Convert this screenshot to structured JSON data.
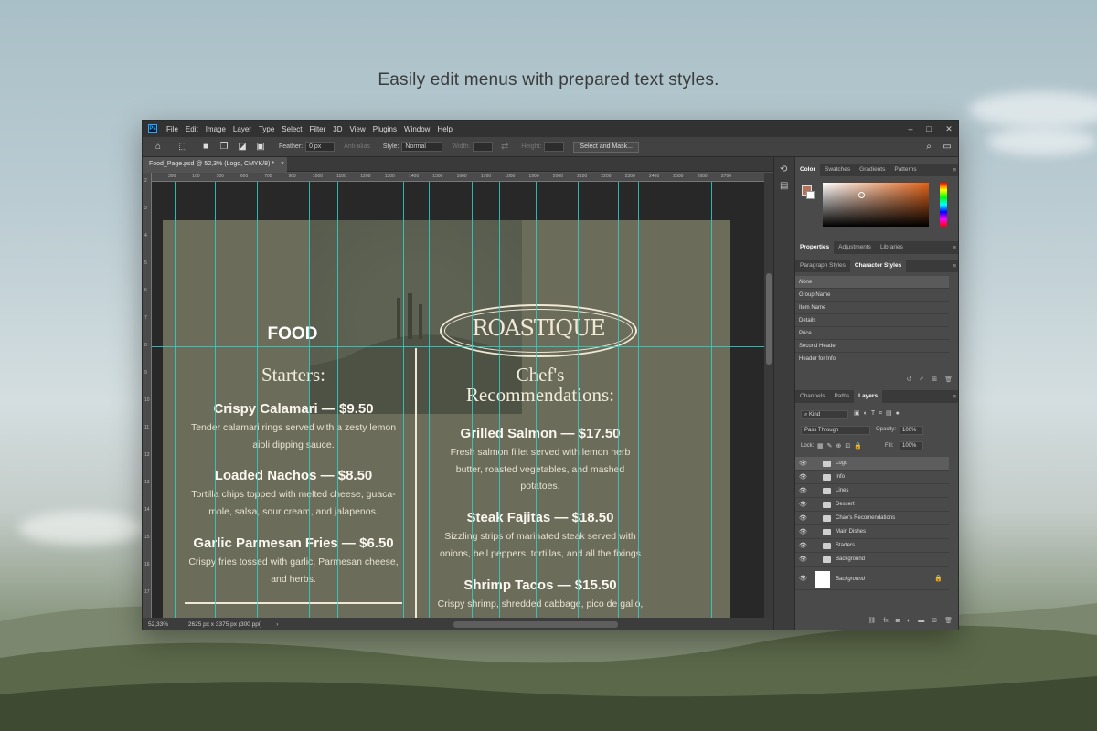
{
  "caption": "Easily edit menus with prepared text styles.",
  "menubar": {
    "logo": "Ps",
    "items": [
      "File",
      "Edit",
      "Image",
      "Layer",
      "Type",
      "Select",
      "Filter",
      "3D",
      "View",
      "Plugins",
      "Window",
      "Help"
    ],
    "controls": [
      "–",
      "□",
      "✕"
    ]
  },
  "options": {
    "feather_label": "Feather:",
    "feather_value": "0 px",
    "anti_alias": "Anti-alias",
    "style_label": "Style:",
    "style_value": "Normal",
    "width_label": "Width:",
    "height_label": "Height:",
    "select_mask": "Select and Mask..."
  },
  "document_tab": {
    "title": "Food_Page.psd @ 52,3% (Logo, CMYK/8) *",
    "close": "×"
  },
  "ruler_h": [
    "300",
    "100",
    "300",
    "600",
    "700",
    "900",
    "1000",
    "1100",
    "1200",
    "1300",
    "1400",
    "1500",
    "1600",
    "1700",
    "1800",
    "1900",
    "2000",
    "2100",
    "2200",
    "2300",
    "2400",
    "2500",
    "2600",
    "2700"
  ],
  "ruler_v": [
    "2",
    "3",
    "4",
    "5",
    "6",
    "7",
    "8",
    "9",
    "10",
    "11",
    "12",
    "13",
    "14",
    "15",
    "16",
    "17"
  ],
  "status": {
    "zoom": "52,33%",
    "size": "2625 px x 3375 px (300 ppi)",
    "arrow": "›"
  },
  "menu": {
    "food_label": "FOOD",
    "logo": "ROASTIQUE",
    "starters": {
      "title": "Starters:",
      "items": [
        {
          "title": "Crispy Calamari — $9.50",
          "desc": [
            "Tender calamari rings served with a zesty lemon",
            "aioli dipping sauce."
          ]
        },
        {
          "title": "Loaded Nachos — $8.50",
          "desc": [
            "Tortilla chips topped with melted cheese, guaca-",
            "mole, salsa, sour cream, and jalapenos."
          ]
        },
        {
          "title": "Garlic Parmesan Fries — $6.50",
          "desc": [
            "Crispy fries tossed with garlic, Parmesan cheese,",
            "and herbs."
          ]
        }
      ]
    },
    "chef": {
      "title_lines": [
        "Chef's",
        "Recommendations:"
      ],
      "items": [
        {
          "title": "Grilled Salmon — $17.50",
          "desc": [
            "Fresh salmon fillet served with lemon herb",
            "butter, roasted vegetables, and mashed",
            "potatoes."
          ]
        },
        {
          "title": "Steak Fajitas — $18.50",
          "desc": [
            "Sizzling strips of marinated steak served with",
            "onions, bell peppers, tortillas, and all the fixings"
          ]
        },
        {
          "title": "Shrimp Tacos — $15.50",
          "desc": [
            "Crispy shrimp, shredded cabbage, pico de gallo,"
          ]
        }
      ]
    }
  },
  "color_panel": {
    "tabs": [
      "Color",
      "Swatches",
      "Gradients",
      "Patterns"
    ],
    "fg": "#b3735a",
    "bg": "#ffffff"
  },
  "properties_panel": {
    "tabs": [
      "Properties",
      "Adjustments",
      "Libraries"
    ]
  },
  "styles_panel": {
    "tabs": [
      "Paragraph Styles",
      "Character Styles"
    ],
    "items": [
      "None",
      "Group Name",
      "Item Name",
      "Details",
      "Price",
      "Second Header",
      "Header for Info"
    ]
  },
  "layers_panel": {
    "tabs": [
      "Channels",
      "Paths",
      "Layers"
    ],
    "filter": "Kind",
    "blend": "Pass Through",
    "opacity_label": "Opacity:",
    "opacity": "100%",
    "lock_label": "Lock:",
    "fill_label": "Fill:",
    "fill": "100%",
    "layers": [
      "Logo",
      "Info",
      "Lines",
      "Dessert",
      "Chae's Recomendations",
      "Main Dishes",
      "Starters",
      "Background"
    ],
    "background_layer": "Background"
  }
}
